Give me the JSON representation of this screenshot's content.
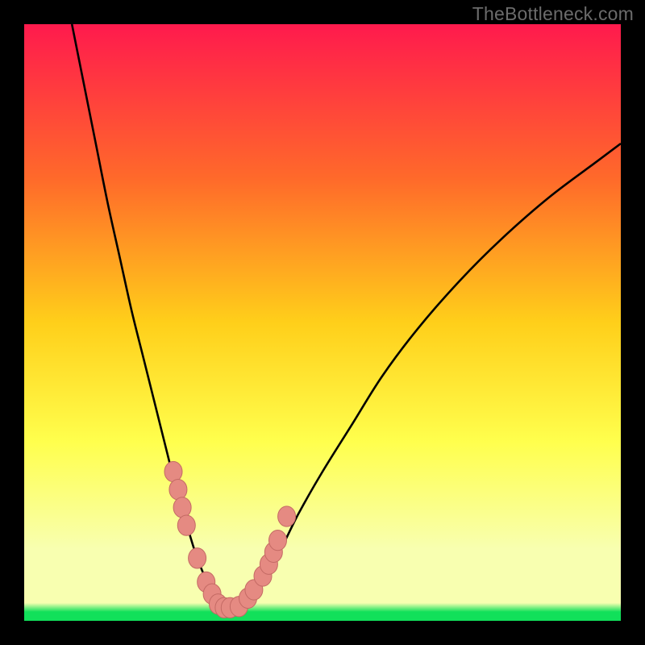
{
  "watermark": "TheBottleneck.com",
  "colors": {
    "frame": "#000000",
    "grad_top": "#ff1a4d",
    "grad_mid1": "#ff6a2a",
    "grad_mid2": "#ffcf1a",
    "grad_mid3": "#ffff4d",
    "grad_low": "#f8ffb0",
    "grad_bottom": "#11e05a",
    "curve": "#000000",
    "marker_fill": "#e58a82",
    "marker_stroke": "#c46a64"
  },
  "chart_data": {
    "type": "line",
    "title": "",
    "xlabel": "",
    "ylabel": "",
    "xlim": [
      0,
      100
    ],
    "ylim": [
      0,
      100
    ],
    "series": [
      {
        "name": "bottleneck-curve",
        "x": [
          8,
          10,
          12,
          14,
          16,
          18,
          20,
          22,
          24,
          25.5,
          27,
          28.5,
          30,
          31.5,
          33,
          34.5,
          36,
          38,
          40,
          43,
          46,
          50,
          55,
          60,
          66,
          73,
          80,
          88,
          96,
          100
        ],
        "values": [
          100,
          90,
          80,
          70,
          61,
          52,
          44,
          36,
          28,
          22,
          17,
          12,
          8,
          5,
          3,
          2.2,
          2.4,
          4,
          7,
          12,
          18,
          25,
          33,
          41,
          49,
          57,
          64,
          71,
          77,
          80
        ]
      }
    ],
    "markers": {
      "name": "highlighted-points",
      "x": [
        25.0,
        25.8,
        26.5,
        27.2,
        29.0,
        30.5,
        31.5,
        32.5,
        33.5,
        34.5,
        36.0,
        37.5,
        38.5,
        40.0,
        41.0,
        41.8,
        42.5,
        44.0
      ],
      "values": [
        25.0,
        22.0,
        19.0,
        16.0,
        10.5,
        6.5,
        4.5,
        2.8,
        2.2,
        2.2,
        2.4,
        3.8,
        5.2,
        7.5,
        9.5,
        11.5,
        13.5,
        17.5
      ]
    }
  }
}
